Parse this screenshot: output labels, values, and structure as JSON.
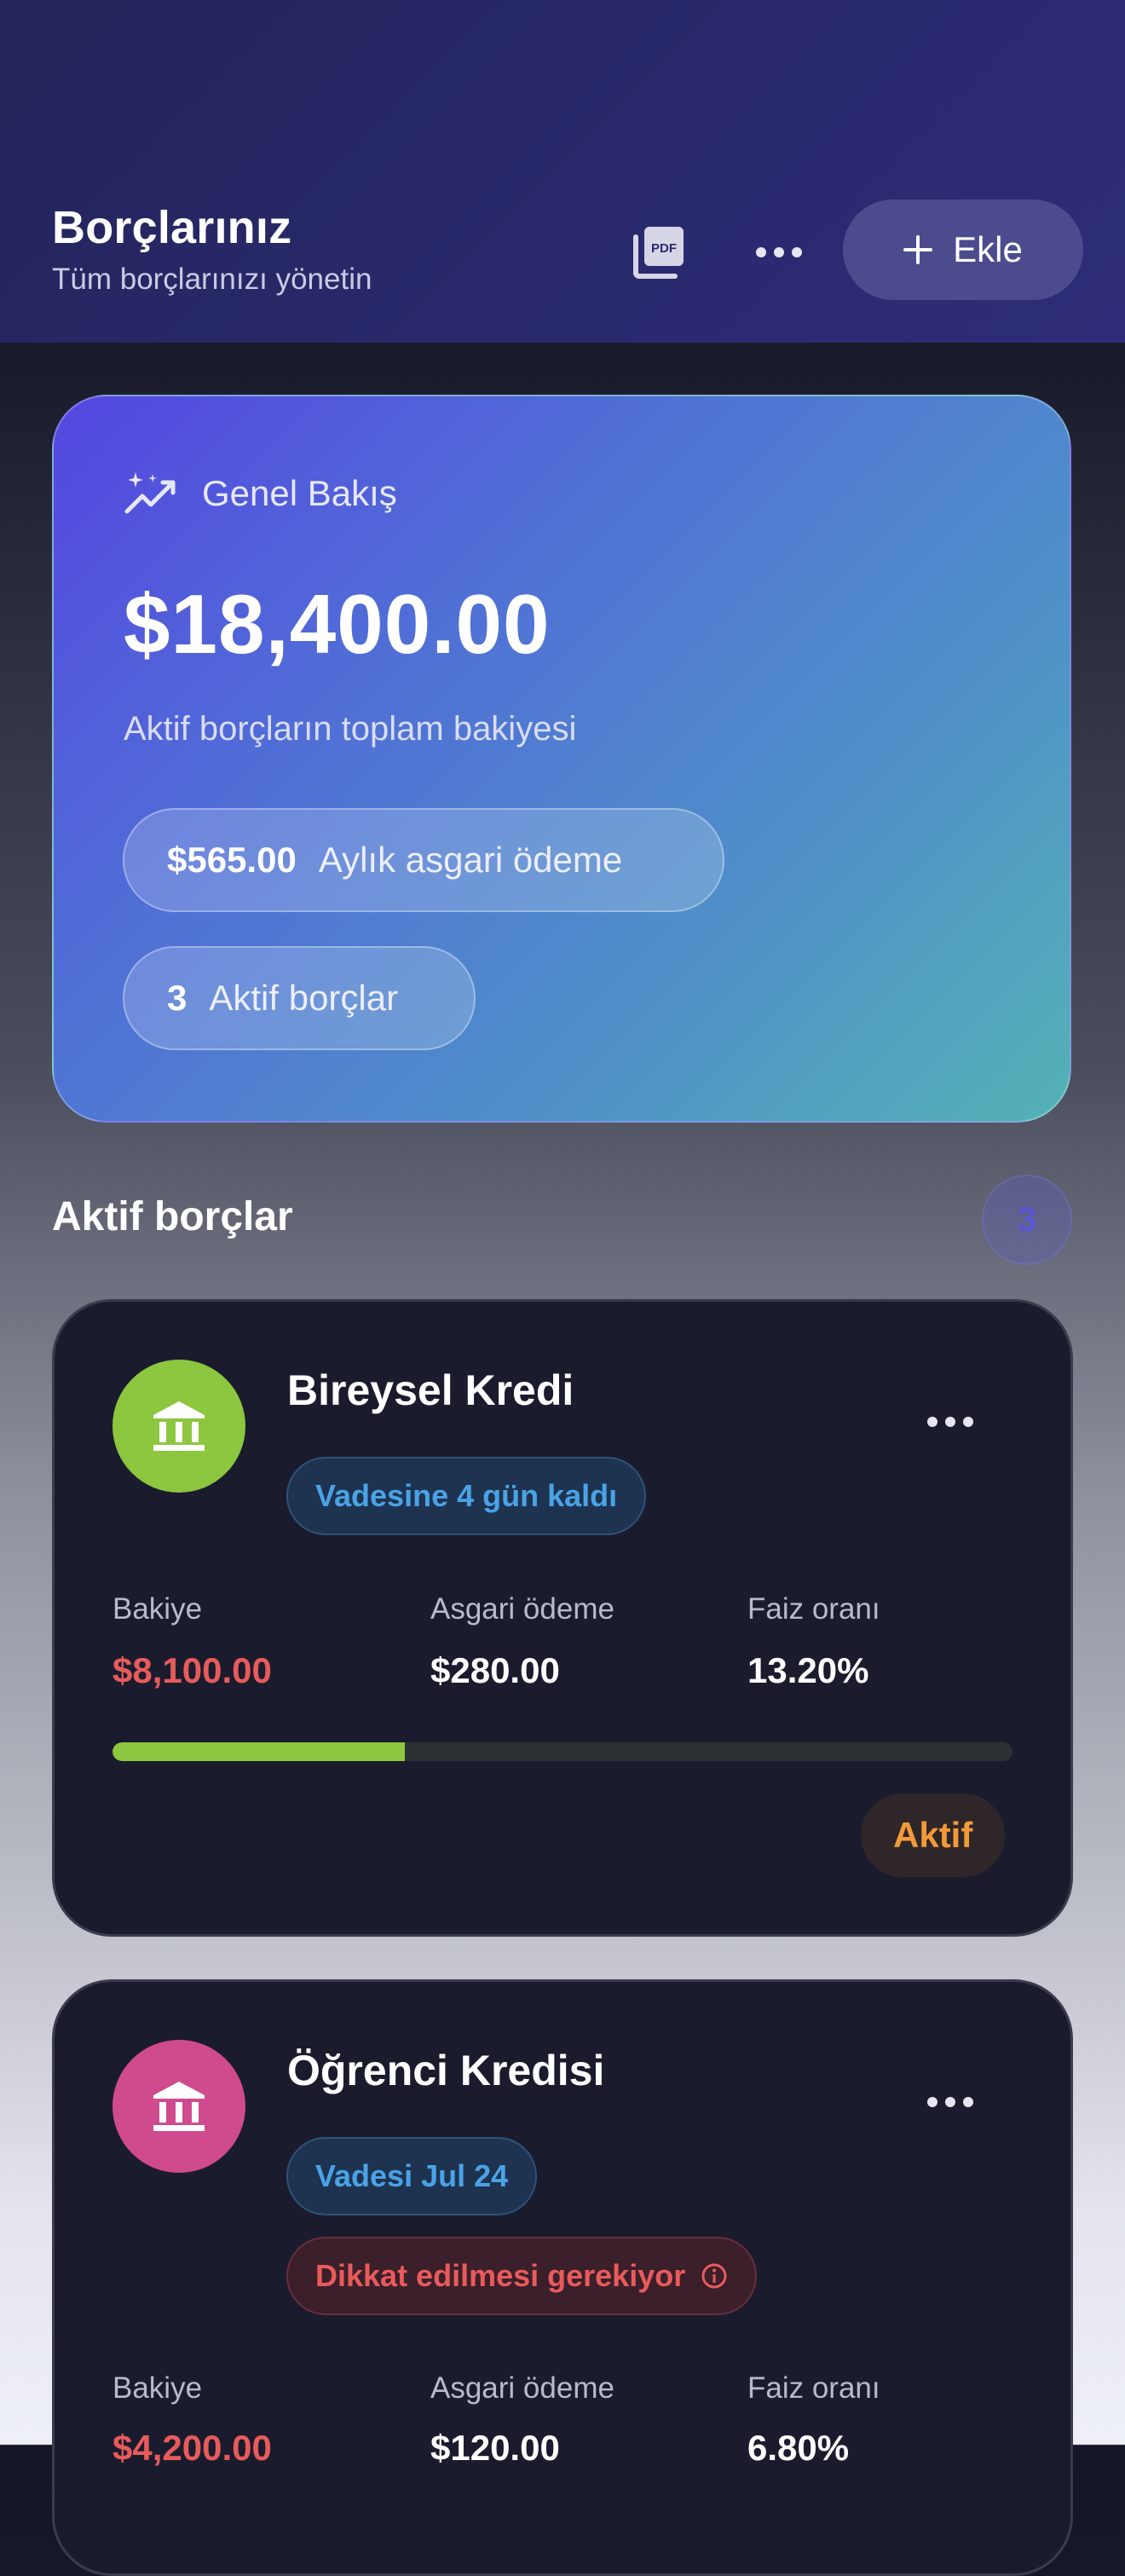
{
  "header": {
    "title": "Borçlarınız",
    "subtitle": "Tüm borçlarınızı yönetin",
    "pdf_icon": "pdf-icon",
    "more_icon": "more-horizontal-icon",
    "add_label": "Ekle"
  },
  "overview": {
    "label": "Genel Bakış",
    "icon": "sparkle-trend-icon",
    "total": "$18,400.00",
    "description": "Aktif borçların toplam bakiyesi",
    "monthly_value": "$565.00",
    "monthly_label": "Aylık asgari ödeme",
    "active_count": "3",
    "active_label": "Aktif borçlar"
  },
  "section": {
    "title": "Aktif borçlar",
    "count": "3"
  },
  "debts": [
    {
      "name": "Bireysel Kredi",
      "icon": "bank-icon",
      "icon_color": "#8dc63f",
      "due_tag": "Vadesine 4 gün kaldı",
      "balance_label": "Bakiye",
      "balance": "$8,100.00",
      "min_label": "Asgari ödeme",
      "min_payment": "$280.00",
      "rate_label": "Faiz oranı",
      "rate": "13.20%",
      "progress": 0.325,
      "status": "Aktif"
    },
    {
      "name": "Öğrenci Kredisi",
      "icon": "bank-icon",
      "icon_color": "#d04a8e",
      "due_tag": "Vadesi Jul 24",
      "warning_tag": "Dikkat edilmesi gerekiyor",
      "warning_icon": "info-icon",
      "balance_label": "Bakiye",
      "balance": "$4,200.00",
      "min_label": "Asgari ödeme",
      "min_payment": "$120.00",
      "rate_label": "Faiz oranı",
      "rate": "6.80%"
    }
  ],
  "colors": {
    "accent": "#5446e0",
    "danger": "#e85b5b",
    "info": "#4aa3e6",
    "warning": "#f39a38"
  }
}
